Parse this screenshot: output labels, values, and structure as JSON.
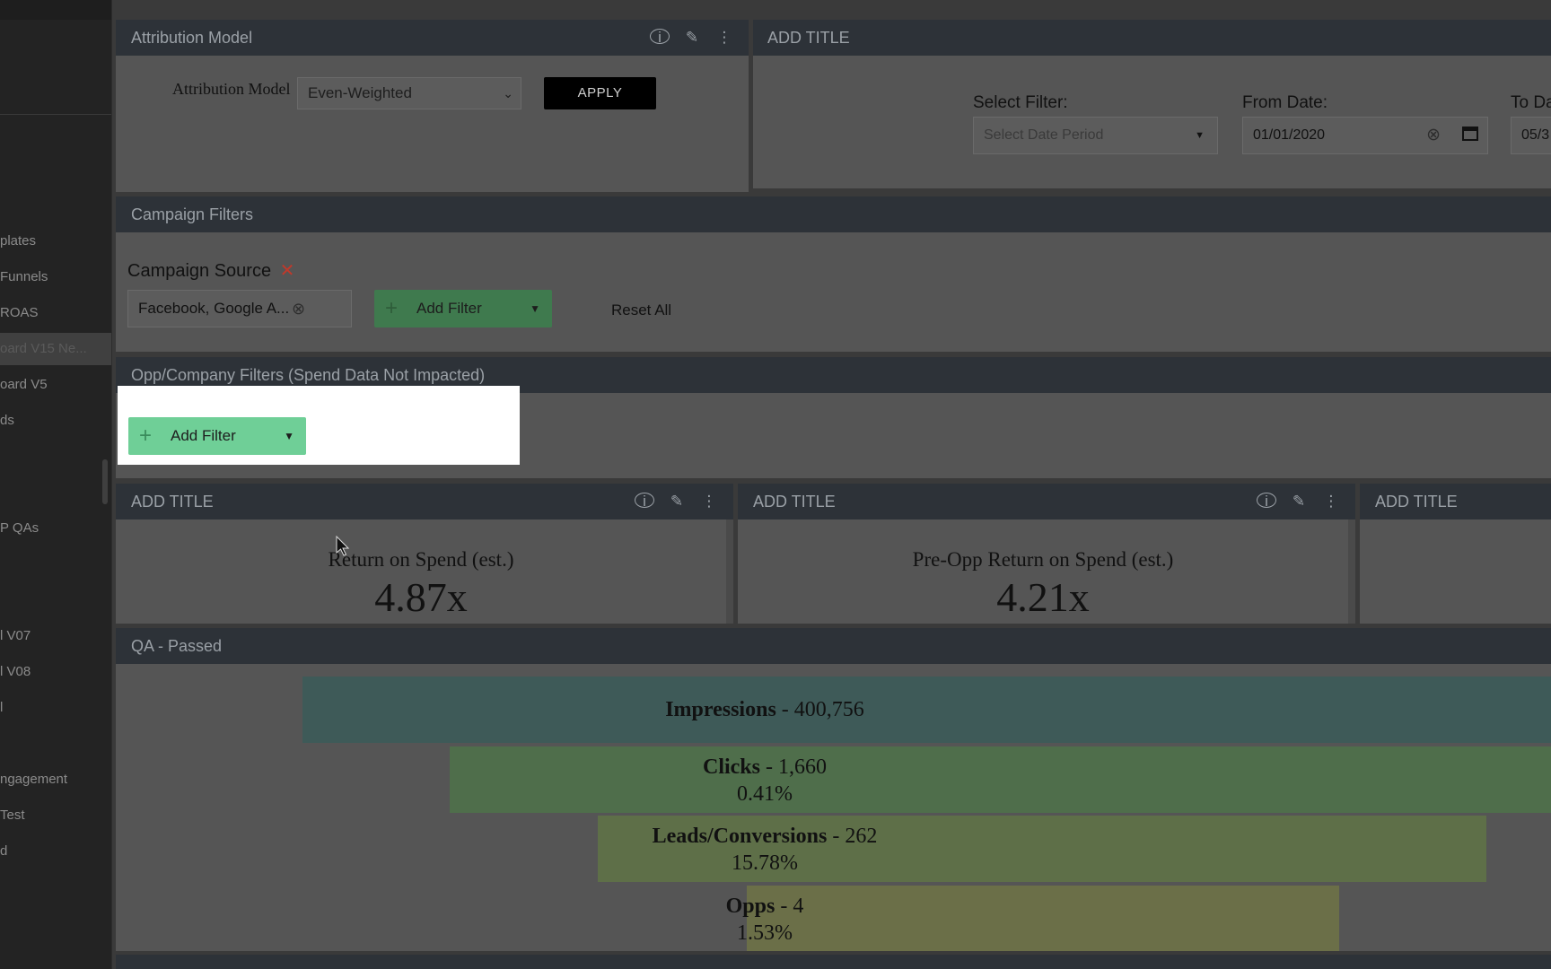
{
  "sidebar": {
    "items": [
      "plates",
      "Funnels",
      "ROAS",
      "oard V15 Ne...",
      "oard V5",
      "ds",
      "P QAs",
      "l V07",
      "l V08",
      "l",
      "ngagement",
      "Test",
      "d"
    ]
  },
  "attribution": {
    "title": "Attribution Model",
    "label": "Attribution Model",
    "selected": "Even-Weighted",
    "apply_label": "APPLY"
  },
  "date_panel": {
    "title": "ADD TITLE",
    "select_filter_label": "Select Filter:",
    "select_filter_placeholder": "Select Date Period",
    "from_date_label": "From Date:",
    "from_date_value": "01/01/2020",
    "to_date_label": "To Da",
    "to_date_value": "05/3"
  },
  "campaign_filters": {
    "title": "Campaign Filters",
    "source_label": "Campaign Source",
    "source_value": "Facebook, Google A...",
    "add_filter_label": "Add Filter",
    "reset_label": "Reset All"
  },
  "opp_filters": {
    "title": "Opp/Company Filters (Spend Data Not Impacted)",
    "add_filter_label": "Add Filter"
  },
  "metrics": [
    {
      "title": "ADD TITLE",
      "label": "Return on Spend (est.)",
      "value": "4.87x"
    },
    {
      "title": "ADD TITLE",
      "label": "Pre-Opp Return on Spend (est.)",
      "value": "4.21x"
    },
    {
      "title": "ADD TITLE"
    }
  ],
  "funnel": {
    "title": "QA - Passed",
    "stages": [
      {
        "name": "Impressions",
        "value": "400,756",
        "sep": " - ",
        "pct": "",
        "color": "#3e5a58"
      },
      {
        "name": "Clicks",
        "value": "1,660",
        "sep": " - ",
        "pct": "0.41%",
        "color": "#4f6e4b"
      },
      {
        "name": "Leads/Conversions",
        "value": "262",
        "sep": " - ",
        "pct": "15.78%",
        "color": "#5e6f48"
      },
      {
        "name": "Opps",
        "value": "4",
        "sep": " - ",
        "pct": "1.53%",
        "color": "#6b6f48"
      }
    ]
  },
  "colors": {
    "panel_header": "#2d3238",
    "highlight_button": "#6fcf97",
    "remove_x": "#c0392b"
  }
}
